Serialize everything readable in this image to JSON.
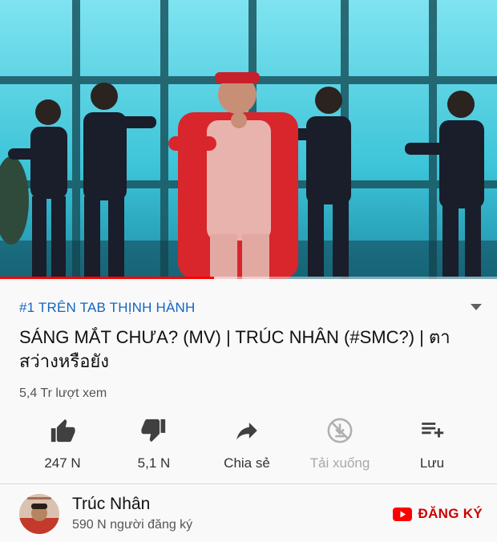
{
  "player": {
    "progress_fraction": 0.43,
    "scene": "music-video-dance-frame"
  },
  "video": {
    "trending_label": "#1 TRÊN TAB THỊNH HÀNH",
    "title": "SÁNG MẮT CHƯA? (MV) | TRÚC NHÂN (#SMC?) | ตาสว่างหรือยัง",
    "views": "5,4 Tr lượt xem"
  },
  "actions": [
    {
      "id": "like",
      "icon": "thumbs-up-icon",
      "label": "247 N",
      "enabled": true
    },
    {
      "id": "dislike",
      "icon": "thumbs-down-icon",
      "label": "5,1 N",
      "enabled": true
    },
    {
      "id": "share",
      "icon": "share-arrow-icon",
      "label": "Chia sẻ",
      "enabled": true
    },
    {
      "id": "download",
      "icon": "download-disabled-icon",
      "label": "Tải xuống",
      "enabled": false
    },
    {
      "id": "save",
      "icon": "playlist-add-icon",
      "label": "Lưu",
      "enabled": true
    }
  ],
  "channel": {
    "name": "Trúc Nhân",
    "subscribers": "590 N người đăng ký",
    "subscribe_label": "ĐĂNG KÝ"
  },
  "colors": {
    "link_blue": "#1565c0",
    "youtube_red": "#ff0000",
    "subscribe_red": "#cc0000",
    "background": "#f9f9f9"
  }
}
